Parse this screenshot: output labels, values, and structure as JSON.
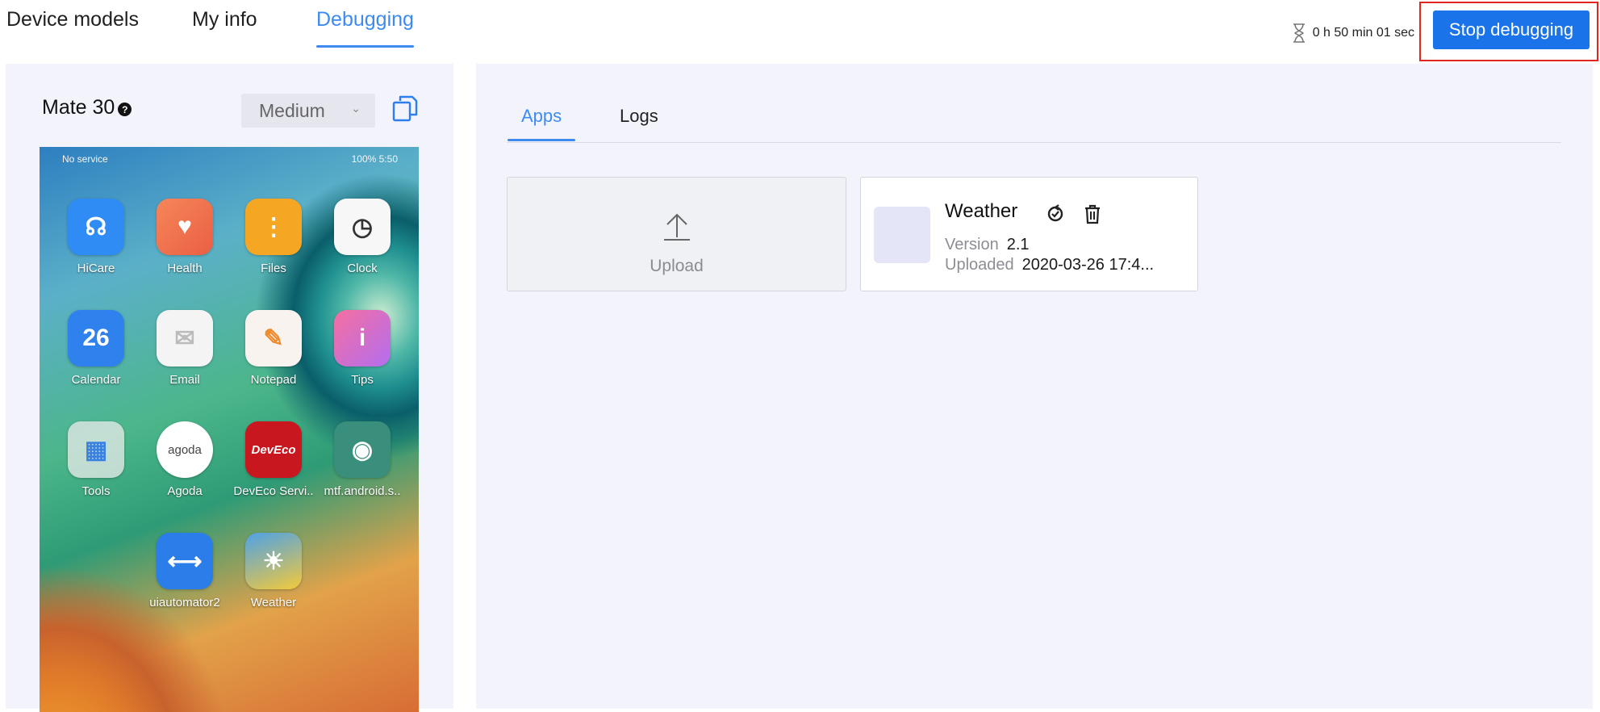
{
  "nav": {
    "tabs": [
      {
        "label": "Device models",
        "active": false
      },
      {
        "label": "My info",
        "active": false
      },
      {
        "label": "Debugging",
        "active": true
      }
    ],
    "timer": "0 h 50 min 01 sec",
    "stop_label": "Stop debugging"
  },
  "device": {
    "name": "Mate 30",
    "help_glyph": "?",
    "quality": "Medium",
    "status_left": "No service",
    "status_right": "100%  5:50",
    "apps": [
      {
        "label": "HiCare",
        "color": "#2f8cf5",
        "glyph": "☊"
      },
      {
        "label": "Health",
        "color": "#f0704a",
        "glyph": "♥"
      },
      {
        "label": "Files",
        "color": "#f5a623",
        "glyph": "⋮"
      },
      {
        "label": "Clock",
        "color": "#f7f7f7",
        "glyph": "◷"
      },
      {
        "label": "Calendar",
        "color": "#2f82ee",
        "glyph": "26"
      },
      {
        "label": "Email",
        "color": "#f4f4f4",
        "glyph": "✉"
      },
      {
        "label": "Notepad",
        "color": "#f8f3ee",
        "glyph": "✎"
      },
      {
        "label": "Tips",
        "color": "#f26ba8",
        "glyph": "i"
      },
      {
        "label": "Tools",
        "color": "#e8e8e8",
        "glyph": "▦"
      },
      {
        "label": "Agoda",
        "color": "#ffffff",
        "glyph": "agoda"
      },
      {
        "label": "DevEco Servi..",
        "color": "#c8171e",
        "glyph": "DevEco"
      },
      {
        "label": "mtf.android.s..",
        "color": "#3a8e7c",
        "glyph": "◉"
      },
      {
        "label": "uiautomator2",
        "color": "#2b7de9",
        "glyph": "⟷"
      },
      {
        "label": "Weather",
        "color": "#4ea2e6",
        "glyph": "☀"
      }
    ]
  },
  "panel": {
    "tabs": [
      {
        "label": "Apps",
        "active": true
      },
      {
        "label": "Logs",
        "active": false
      }
    ],
    "upload_label": "Upload",
    "app": {
      "name": "Weather",
      "version_key": "Version",
      "version": "2.1",
      "uploaded_key": "Uploaded",
      "uploaded": "2020-03-26 17:4..."
    }
  },
  "colors": {
    "accent": "#3d8bf0",
    "stop_button": "#1a73e8",
    "highlight_frame": "#e0261f",
    "panel_bg": "#f3f4fb"
  }
}
